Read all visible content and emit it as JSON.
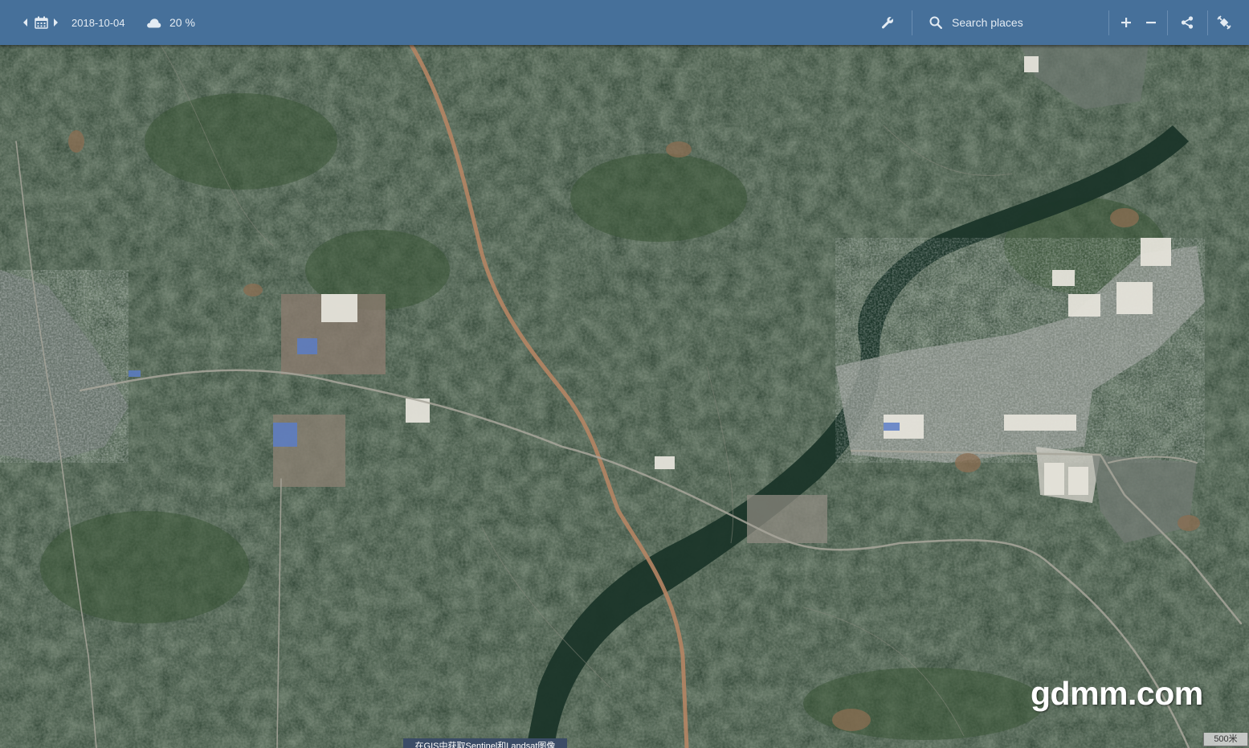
{
  "toolbar": {
    "date": "2018-10-04",
    "cloud_coverage": "20 %",
    "search_placeholder": "Search places"
  },
  "icons": {
    "prev": "caret-left-icon",
    "calendar": "calendar-icon",
    "next": "caret-right-icon",
    "cloud": "cloud-icon",
    "tools": "wrench-icon",
    "search": "search-icon",
    "zoom_in": "plus-icon",
    "zoom_out": "minus-icon",
    "share": "share-icon",
    "compare": "satellite-icon"
  },
  "map": {
    "watermark": "gdmm.com",
    "scale_label": "500米",
    "caption": "在GIS中获取Sentinel和Landsat图像"
  },
  "colors": {
    "toolbar": "#46709a",
    "vegetation": "#243a2a",
    "river": "#1e3a2c",
    "road": "#b58564"
  }
}
